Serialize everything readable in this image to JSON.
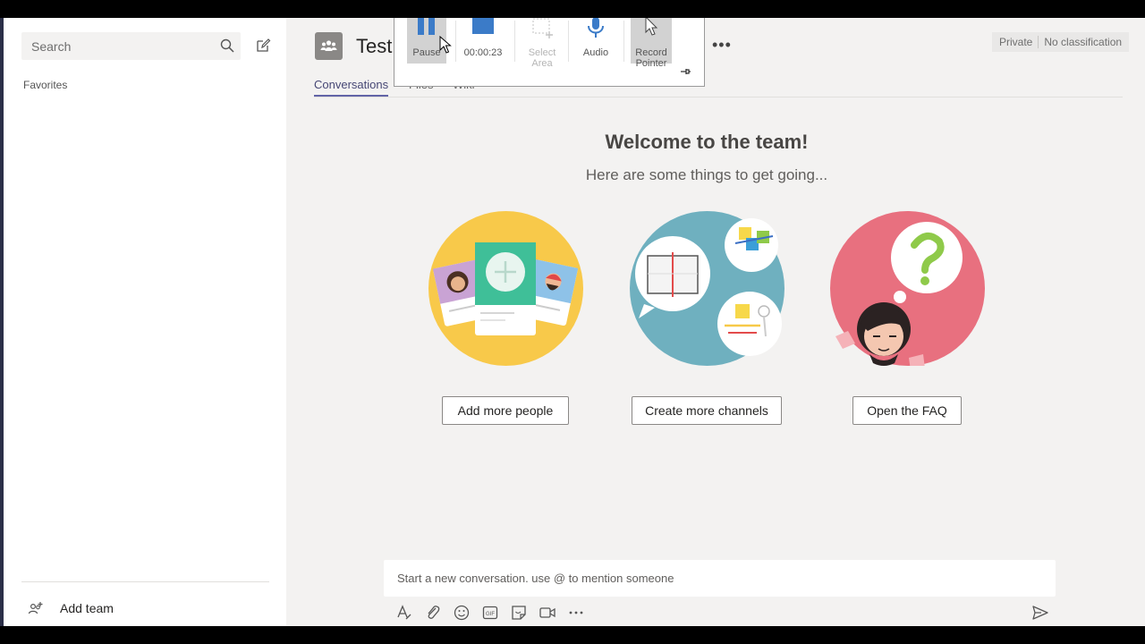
{
  "sidebar": {
    "search_placeholder": "Search",
    "favorites_label": "Favorites",
    "add_team_label": "Add team"
  },
  "header": {
    "team_name": "Test",
    "tabs": [
      {
        "label": "Conversations",
        "active": true
      },
      {
        "label": "Files",
        "active": false
      },
      {
        "label": "Wiki",
        "active": false
      }
    ],
    "privacy": "Private",
    "classification": "No classification"
  },
  "recorder": {
    "pause_label": "Pause",
    "timer": "00:00:23",
    "select_area_label": "Select Area",
    "audio_label": "Audio",
    "record_pointer_label": "Record Pointer"
  },
  "welcome": {
    "title": "Welcome to the team!",
    "subtitle": "Here are some things to get going...",
    "actions": [
      {
        "label": "Add more people"
      },
      {
        "label": "Create more channels"
      },
      {
        "label": "Open the FAQ"
      }
    ]
  },
  "compose": {
    "placeholder": "Start a new conversation. use @ to mention someone"
  },
  "colors": {
    "accent": "#6264a7",
    "app_background": "#f3f2f1",
    "sidebar_background": "#ffffff",
    "people_circle": "#f8c94a",
    "channels_circle": "#6fb0bf",
    "faq_circle": "#e8707f",
    "faq_question": "#8fca4a"
  },
  "icons": {
    "search": "search-icon",
    "compose": "compose-icon",
    "add_team": "add-team-icon",
    "team": "team-icon",
    "send": "send-icon"
  }
}
